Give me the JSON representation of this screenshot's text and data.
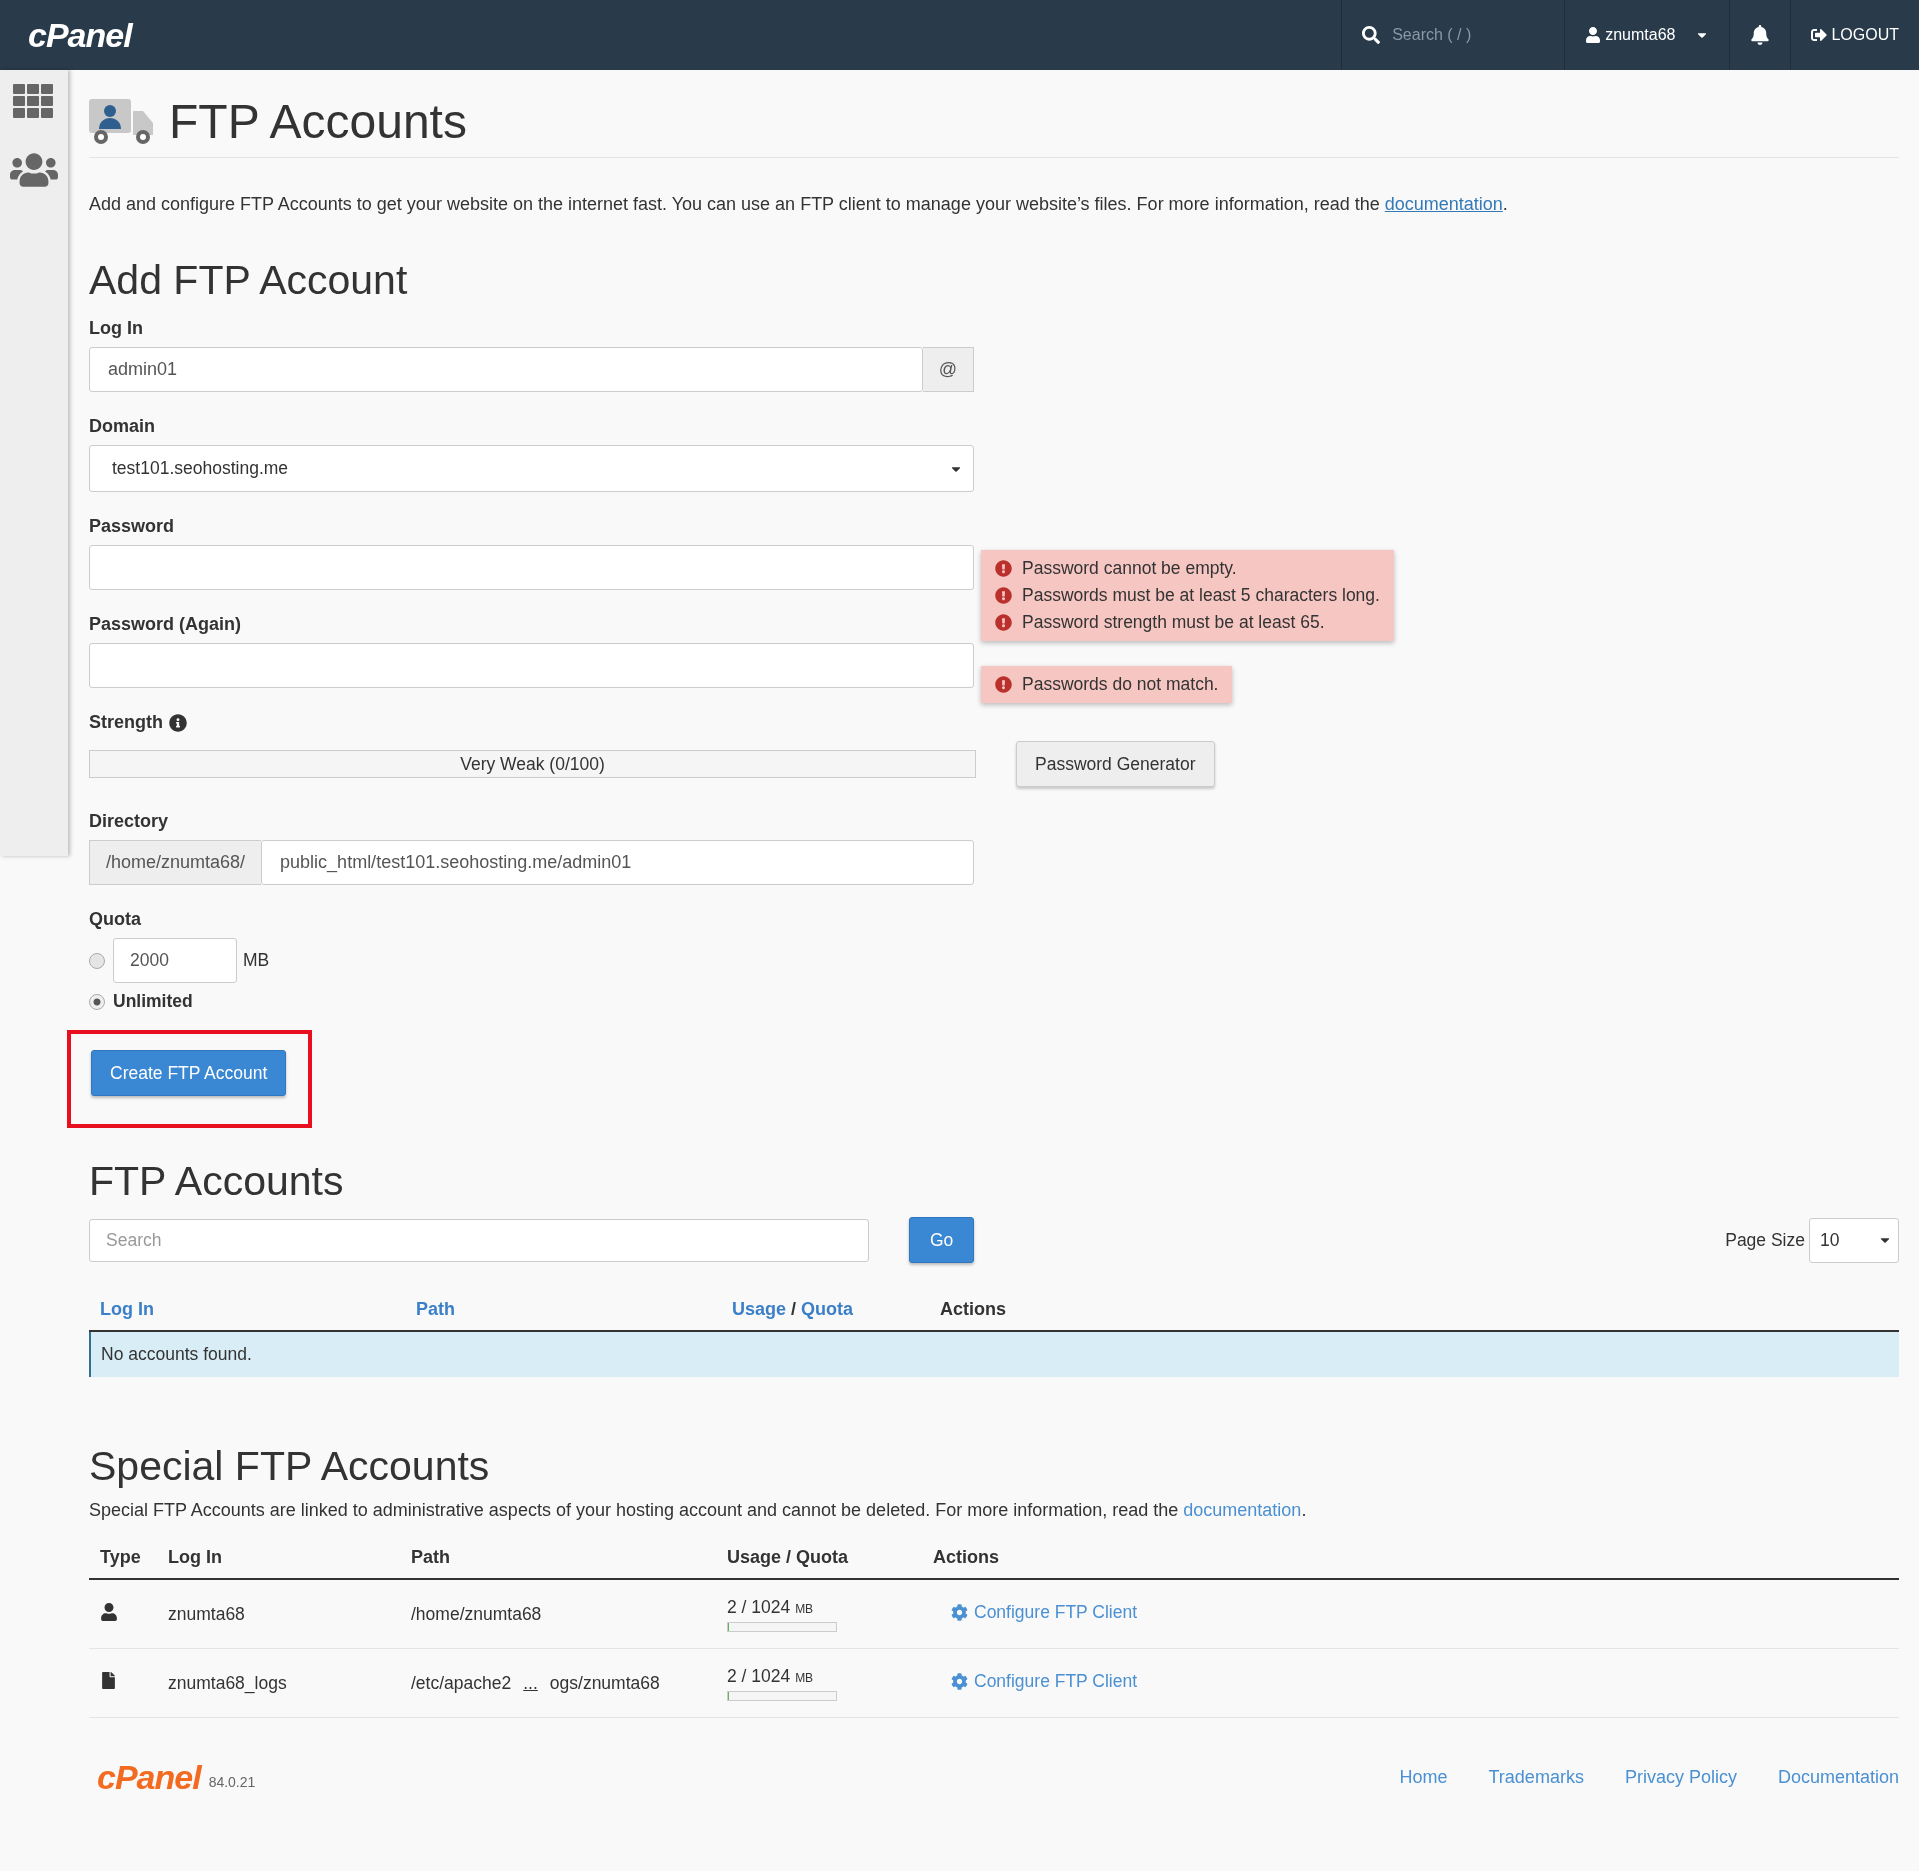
{
  "topbar": {
    "logo": "cPanel",
    "search": {
      "placeholder": "Search ( / )"
    },
    "user": "znumta68",
    "logout": "LOGOUT"
  },
  "page": {
    "title": "FTP Accounts",
    "description": "Add and configure FTP Accounts to get your website on the internet fast. You can use an FTP client to manage your website’s files. For more information, read the ",
    "description_link": "documentation",
    "description_end": "."
  },
  "add_form": {
    "heading": "Add FTP Account",
    "login": {
      "label": "Log In",
      "value": "admin01",
      "addon": "@"
    },
    "domain": {
      "label": "Domain",
      "value": "test101.seohosting.me"
    },
    "password": {
      "label": "Password",
      "errors": [
        "Password cannot be empty.",
        "Passwords must be at least 5 characters long.",
        "Password strength must be at least 65."
      ]
    },
    "password_again": {
      "label": "Password (Again)",
      "errors": [
        "Passwords do not match."
      ]
    },
    "strength": {
      "label": "Strength",
      "level": 0,
      "reading": "Very Weak (0/100)",
      "generator_button": "Password Generator"
    },
    "directory": {
      "label": "Directory",
      "prefix": "/home/znumta68/",
      "value": "public_html/test101.seohosting.me/admin01"
    },
    "quota": {
      "label": "Quota",
      "options": [
        {
          "kind": "amount",
          "value": "2000",
          "unit": "MB",
          "selected": false
        },
        {
          "kind": "unlimited",
          "label": "Unlimited",
          "selected": true
        }
      ]
    },
    "submit": "Create FTP Account",
    "submit_highlighted": true
  },
  "accounts": {
    "heading": "FTP Accounts",
    "search": {
      "placeholder": "Search"
    },
    "go_button": "Go",
    "page_size_label": "Page Size",
    "page_size": "10",
    "columns": [
      {
        "kind": "link",
        "label": "Log In"
      },
      {
        "kind": "link",
        "label": "Path"
      },
      {
        "kind": "pair",
        "label": "Usage",
        "label2": "Quota",
        "sep": "/"
      },
      {
        "kind": "plain",
        "label": "Actions"
      }
    ],
    "empty_message": "No accounts found."
  },
  "special": {
    "heading": "Special FTP Accounts",
    "description": "Special FTP Accounts are linked to administrative aspects of your hosting account and cannot be deleted. For more information, read the ",
    "description_link": "documentation",
    "description_end": ".",
    "columns": [
      "Type",
      "Log In",
      "Path",
      "Usage / Quota",
      "Actions"
    ],
    "rows": [
      {
        "kind": "user",
        "login": "znumta68",
        "path": "/home/znumta68",
        "usage": "2 / 1024",
        "unit": "MB",
        "level": 0.002,
        "action": "Configure FTP Client"
      },
      {
        "kind": "file",
        "login": "znumta68_logs",
        "path_start": "/etc/apache2",
        "path_ellipsis": "...",
        "path_end": "ogs/znumta68",
        "usage": "2 / 1024",
        "unit": "MB",
        "level": 0.002,
        "action": "Configure FTP Client"
      }
    ]
  },
  "footer": {
    "logo": "cPanel",
    "version": "84.0.21",
    "links": [
      "Home",
      "Trademarks",
      "Privacy Policy",
      "Documentation"
    ]
  }
}
